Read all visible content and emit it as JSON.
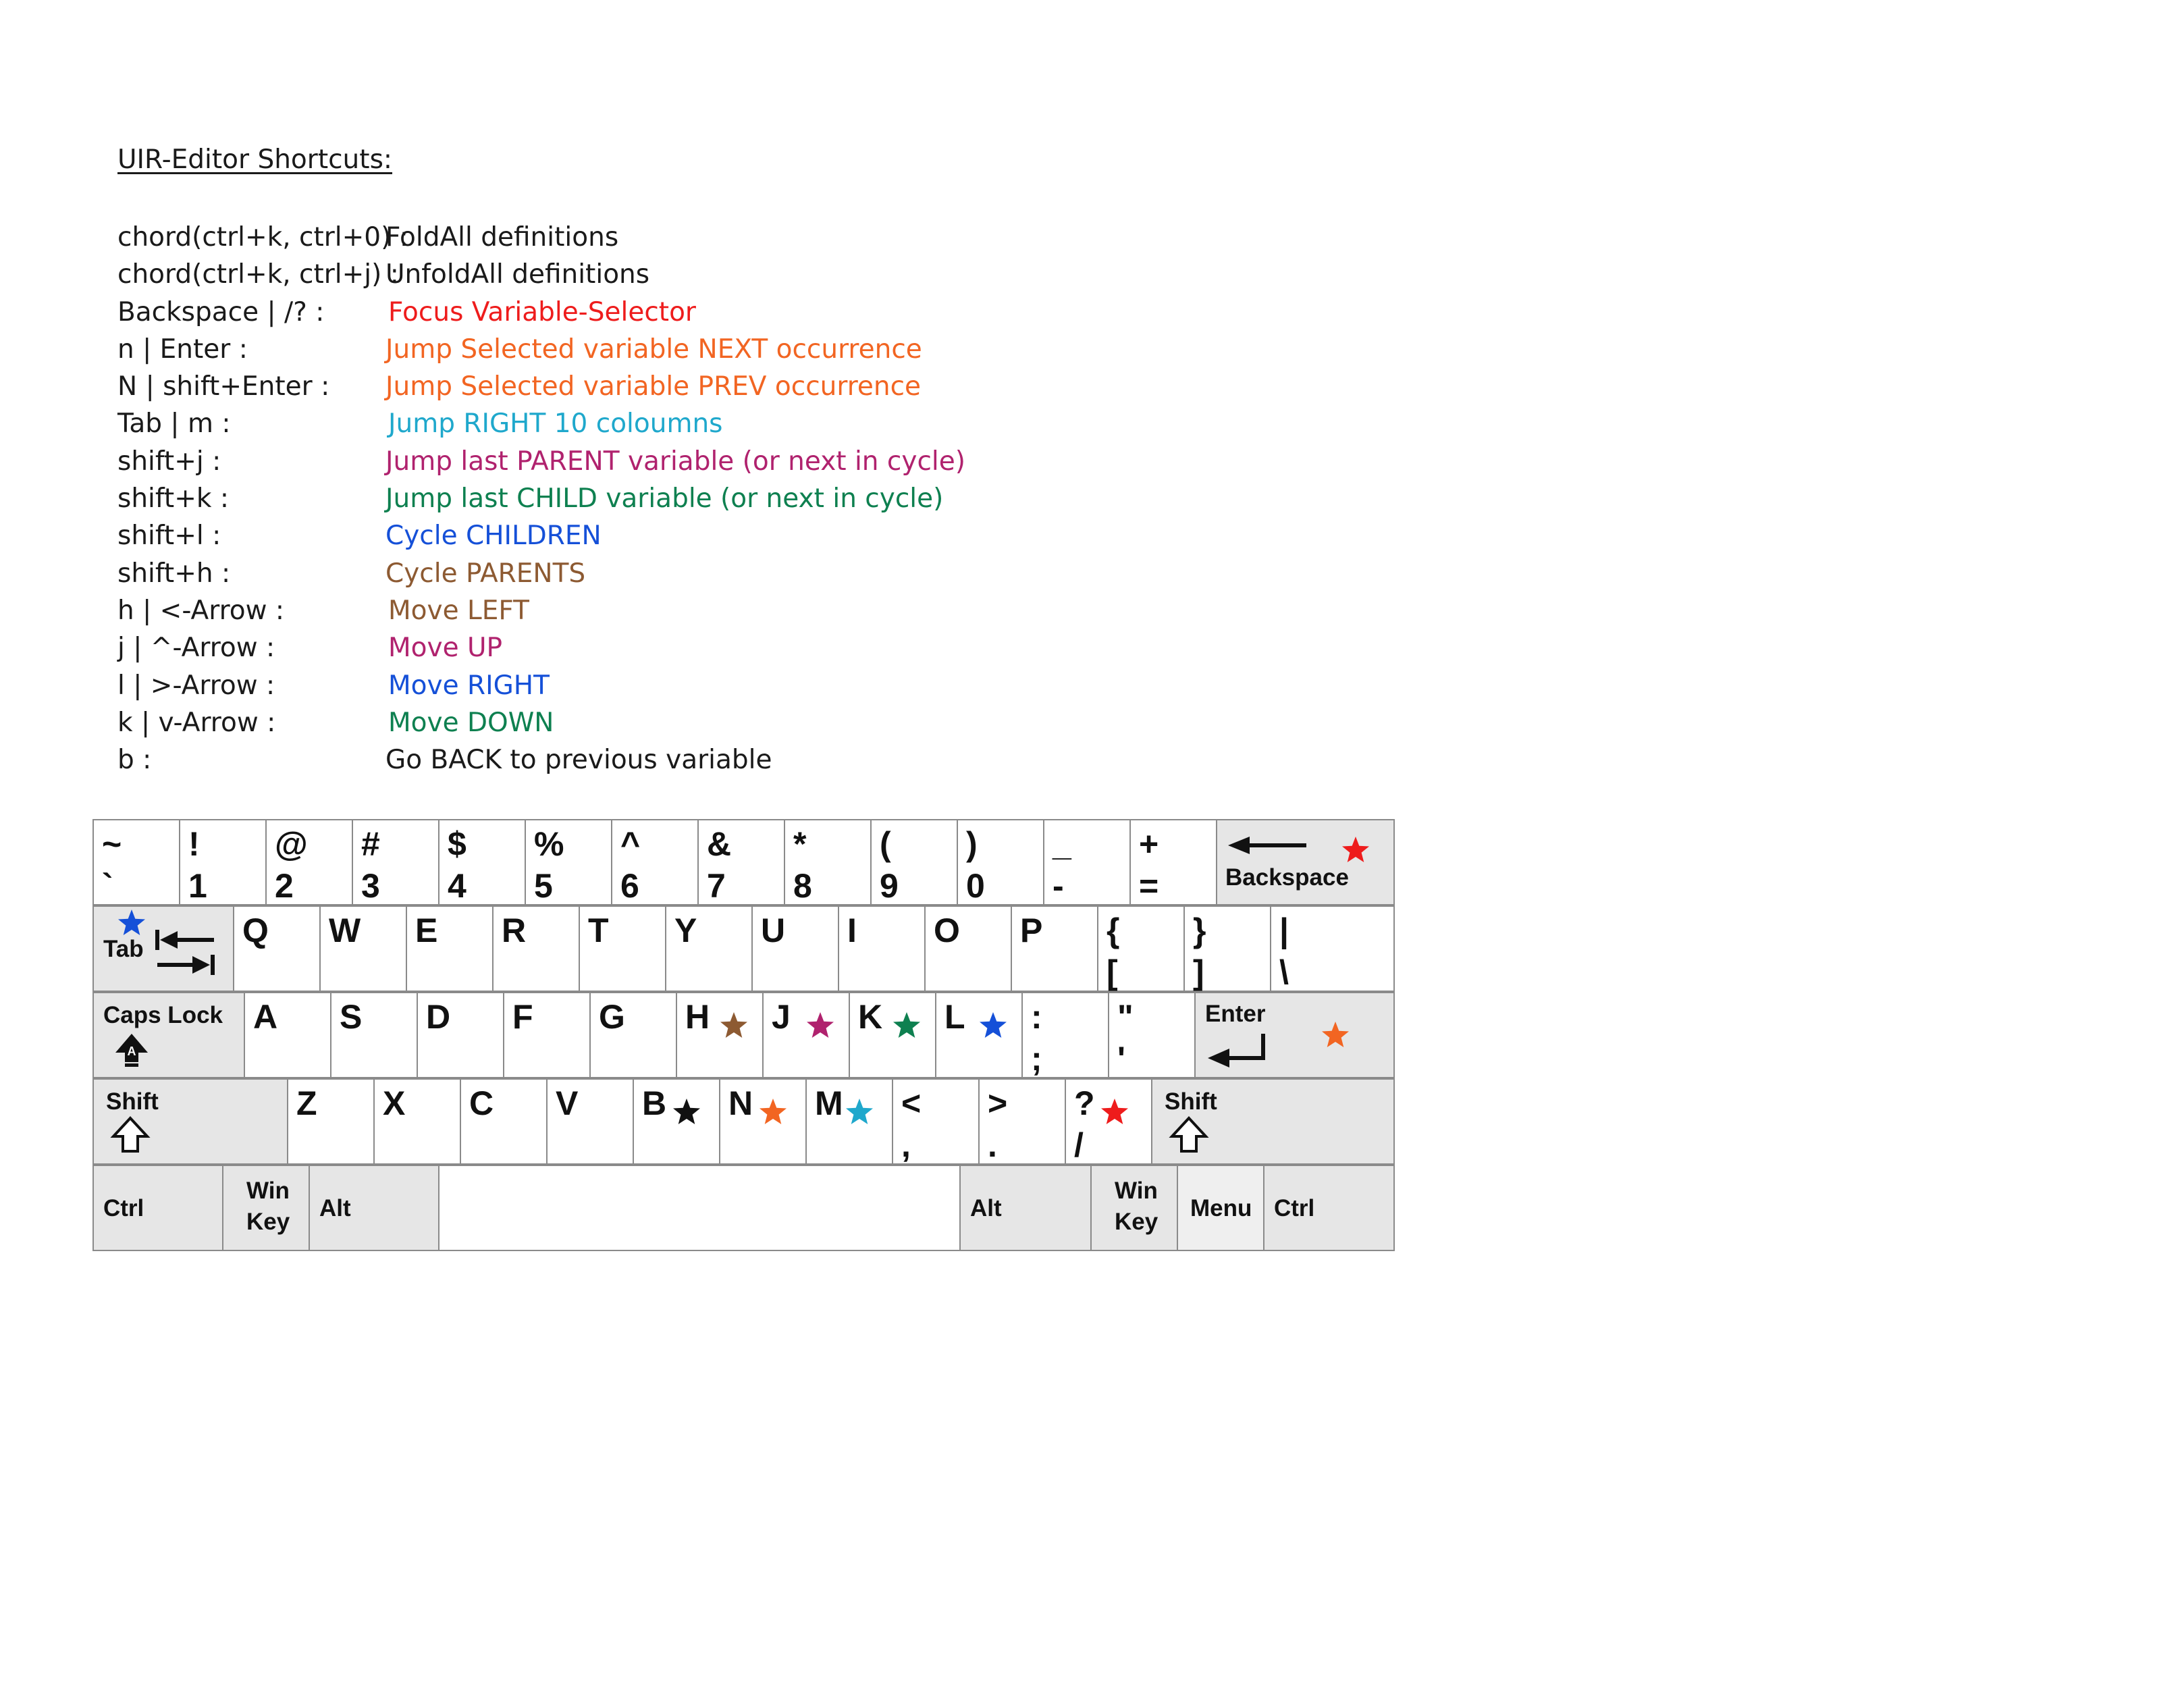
{
  "title": "UIR-Editor Shortcuts:",
  "shortcuts": [
    {
      "key": "chord(ctrl+k, ctrl+0) :",
      "desc": "FoldAll definitions",
      "color": "#1a1a1a"
    },
    {
      "key": "chord(ctrl+k, ctrl+j) :",
      "desc": "UnfoldAll definitions",
      "color": "#1a1a1a"
    },
    {
      "key": "Backspace | /? :",
      "desc": "Focus Variable-Selector",
      "color": "#ee1c1c"
    },
    {
      "key": "n | Enter :",
      "desc": "Jump Selected variable NEXT occurrence",
      "color": "#f26522"
    },
    {
      "key": "N | shift+Enter :",
      "desc": "Jump Selected variable PREV occurrence",
      "color": "#f26522"
    },
    {
      "key": "Tab | m :",
      "desc": "Jump RIGHT 10 coloumns",
      "color": "#1fa8cc"
    },
    {
      "key": "shift+j :",
      "desc": "Jump last PARENT variable (or next in cycle)",
      "color": "#b0226e"
    },
    {
      "key": "shift+k :",
      "desc": "Jump last CHILD variable (or next in cycle)",
      "color": "#0e8050"
    },
    {
      "key": "shift+l :",
      "desc": "Cycle CHILDREN",
      "color": "#1550d8"
    },
    {
      "key": "shift+h :",
      "desc": "Cycle PARENTS",
      "color": "#8d5a32"
    },
    {
      "key": "h | <-Arrow :",
      "desc": "Move LEFT",
      "color": "#8d5a32"
    },
    {
      "key": "j | ^-Arrow :",
      "desc": "Move UP",
      "color": "#b0226e"
    },
    {
      "key": "l | >-Arrow :",
      "desc": "Move RIGHT",
      "color": "#1550d8"
    },
    {
      "key": "k | v-Arrow :",
      "desc": "Move DOWN",
      "color": "#0e8050"
    },
    {
      "key": "b :",
      "desc": "Go BACK to previous variable",
      "color": "#1a1a1a"
    }
  ],
  "keyboard": {
    "rows": [
      [
        {
          "id": "backtick",
          "top": "~",
          "bottom": "`"
        },
        {
          "id": "1",
          "top": "!",
          "bottom": "1"
        },
        {
          "id": "2",
          "top": "@",
          "bottom": "2"
        },
        {
          "id": "3",
          "top": "#",
          "bottom": "3"
        },
        {
          "id": "4",
          "top": "$",
          "bottom": "4"
        },
        {
          "id": "5",
          "top": "%",
          "bottom": "5"
        },
        {
          "id": "6",
          "top": "^",
          "bottom": "6"
        },
        {
          "id": "7",
          "top": "&",
          "bottom": "7"
        },
        {
          "id": "8",
          "top": "*",
          "bottom": "8"
        },
        {
          "id": "9",
          "top": "(",
          "bottom": "9"
        },
        {
          "id": "0",
          "top": ")",
          "bottom": "0"
        },
        {
          "id": "minus",
          "top": "_",
          "bottom": "-"
        },
        {
          "id": "equals",
          "top": "+",
          "bottom": "="
        },
        {
          "id": "backspace",
          "label": "Backspace",
          "mod": true,
          "star": "#ee1c1c",
          "icon": "arrow-left"
        }
      ],
      [
        {
          "id": "tab",
          "label": "Tab",
          "mod": true,
          "star": "#1550d8",
          "icon": "tab-arrows"
        },
        {
          "id": "q",
          "main": "Q"
        },
        {
          "id": "w",
          "main": "W"
        },
        {
          "id": "e",
          "main": "E"
        },
        {
          "id": "r",
          "main": "R"
        },
        {
          "id": "t",
          "main": "T"
        },
        {
          "id": "y",
          "main": "Y"
        },
        {
          "id": "u",
          "main": "U"
        },
        {
          "id": "i",
          "main": "I"
        },
        {
          "id": "o",
          "main": "O"
        },
        {
          "id": "p",
          "main": "P"
        },
        {
          "id": "lbracket",
          "top": "{",
          "bottom": "["
        },
        {
          "id": "rbracket",
          "top": "}",
          "bottom": "]"
        },
        {
          "id": "backslash",
          "top": "|",
          "bottom": "\\"
        }
      ],
      [
        {
          "id": "capslock",
          "label": "Caps Lock",
          "mod": true,
          "icon": "caps-arrow"
        },
        {
          "id": "a",
          "main": "A"
        },
        {
          "id": "s",
          "main": "S"
        },
        {
          "id": "d",
          "main": "D"
        },
        {
          "id": "f",
          "main": "F"
        },
        {
          "id": "g",
          "main": "G"
        },
        {
          "id": "h",
          "main": "H",
          "star": "#8d5a32"
        },
        {
          "id": "j",
          "main": "J",
          "star": "#b0226e"
        },
        {
          "id": "k",
          "main": "K",
          "star": "#0e8050"
        },
        {
          "id": "l",
          "main": "L",
          "star": "#1550d8"
        },
        {
          "id": "semicolon",
          "top": ":",
          "bottom": ";"
        },
        {
          "id": "quote",
          "top": "\"",
          "bottom": "'"
        },
        {
          "id": "enter",
          "label": "Enter",
          "mod": true,
          "star": "#f26522",
          "icon": "enter-arrow"
        }
      ],
      [
        {
          "id": "lshift",
          "label": "Shift",
          "mod": true,
          "icon": "shift-arrow"
        },
        {
          "id": "z",
          "main": "Z"
        },
        {
          "id": "x",
          "main": "X"
        },
        {
          "id": "c",
          "main": "C"
        },
        {
          "id": "v",
          "main": "V"
        },
        {
          "id": "b",
          "main": "B",
          "star": "#111111"
        },
        {
          "id": "n",
          "main": "N",
          "star": "#f26522"
        },
        {
          "id": "m",
          "main": "M",
          "star": "#1fa8cc"
        },
        {
          "id": "comma",
          "top": "<",
          "bottom": ","
        },
        {
          "id": "period",
          "top": ">",
          "bottom": "."
        },
        {
          "id": "slash",
          "top": "?",
          "bottom": "/",
          "star": "#ee1c1c"
        },
        {
          "id": "rshift",
          "label": "Shift",
          "mod": true,
          "icon": "shift-arrow"
        }
      ],
      [
        {
          "id": "lctrl",
          "label": "Ctrl",
          "mod": true
        },
        {
          "id": "lwin",
          "label": "Win\nKey",
          "mod": true
        },
        {
          "id": "lalt",
          "label": "Alt",
          "mod": true
        },
        {
          "id": "space",
          "label": ""
        },
        {
          "id": "ralt",
          "label": "Alt",
          "mod": true
        },
        {
          "id": "rwin",
          "label": "Win\nKey",
          "mod": true
        },
        {
          "id": "menu",
          "label": "Menu",
          "mod": true
        },
        {
          "id": "rctrl",
          "label": "Ctrl",
          "mod": true
        }
      ]
    ]
  }
}
